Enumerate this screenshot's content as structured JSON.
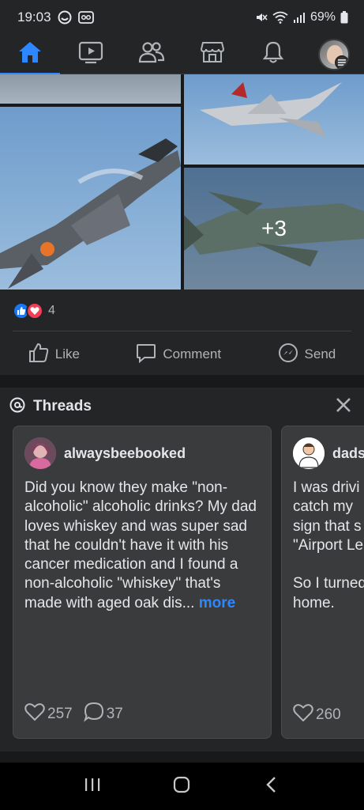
{
  "status_bar": {
    "time": "19:03",
    "battery": "69%"
  },
  "nav": {
    "items": [
      {
        "name": "home",
        "icon": "home-icon",
        "active": true
      },
      {
        "name": "video",
        "icon": "video-icon",
        "active": false
      },
      {
        "name": "friends",
        "icon": "friends-icon",
        "active": false
      },
      {
        "name": "marketplace",
        "icon": "marketplace-icon",
        "active": false
      },
      {
        "name": "notifications",
        "icon": "bell-icon",
        "active": false
      },
      {
        "name": "profile-menu",
        "icon": "avatar",
        "active": false
      }
    ]
  },
  "post": {
    "photo_overlay": "+3",
    "reaction_count": "4",
    "actions": {
      "like": "Like",
      "comment": "Comment",
      "send": "Send"
    }
  },
  "threads": {
    "title": "Threads",
    "cards": [
      {
        "username": "alwaysbeebooked",
        "text": "Did you know they make \"non-alcoholic\" alcoholic drinks? My dad loves whiskey and was super sad that he couldn't have it with his cancer medication and I found a non-alcoholic \"whiskey\" that's made with aged oak dis...",
        "more": "more",
        "likes": "257",
        "replies": "37"
      },
      {
        "username": "dads",
        "text": "I was drivi\ncatch my\nsign that s\n\"Airport Le\n\nSo I turned\nhome.",
        "likes": "260"
      }
    ]
  },
  "colors": {
    "accent": "#2d88ff",
    "background": "#18191a",
    "surface": "#242526",
    "card": "#3a3b3c"
  }
}
